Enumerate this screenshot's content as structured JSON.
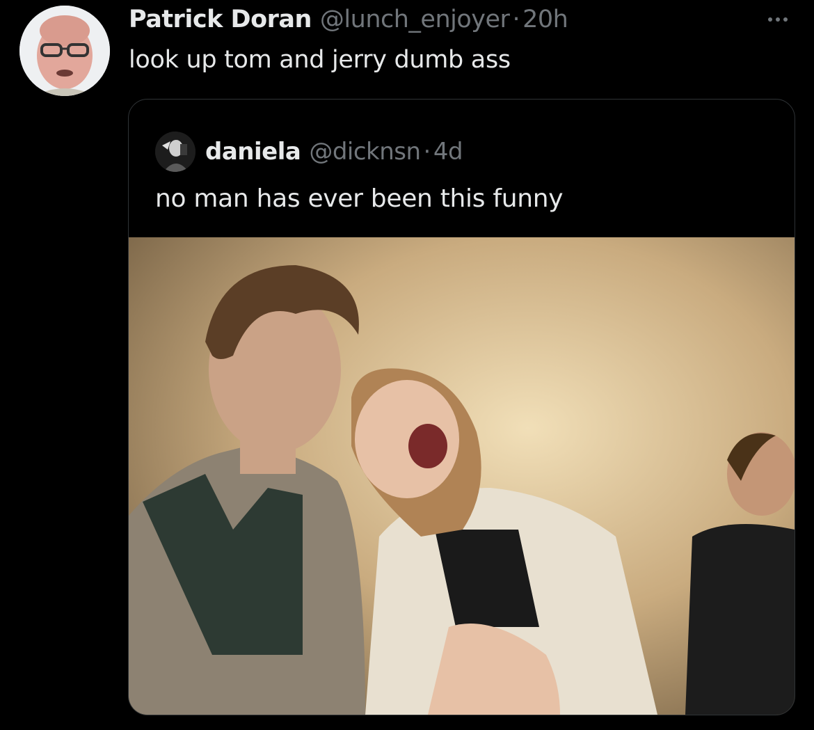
{
  "tweet": {
    "author_name": "Patrick Doran",
    "author_handle": "@lunch_enjoyer",
    "separator": "·",
    "timestamp": "20h",
    "text": "look up tom and jerry dumb ass",
    "avatar_icon": "profile-photo",
    "more_icon": "more-horizontal-icon"
  },
  "quoted_tweet": {
    "author_name": "daniela",
    "author_handle": "@dicknsn",
    "separator": "·",
    "timestamp": "4d",
    "text": "no man has ever been this funny",
    "media_type": "photo"
  },
  "colors": {
    "background": "#000000",
    "primary_text": "#e7e9ea",
    "secondary_text": "#71767b",
    "border": "#2f3336"
  }
}
